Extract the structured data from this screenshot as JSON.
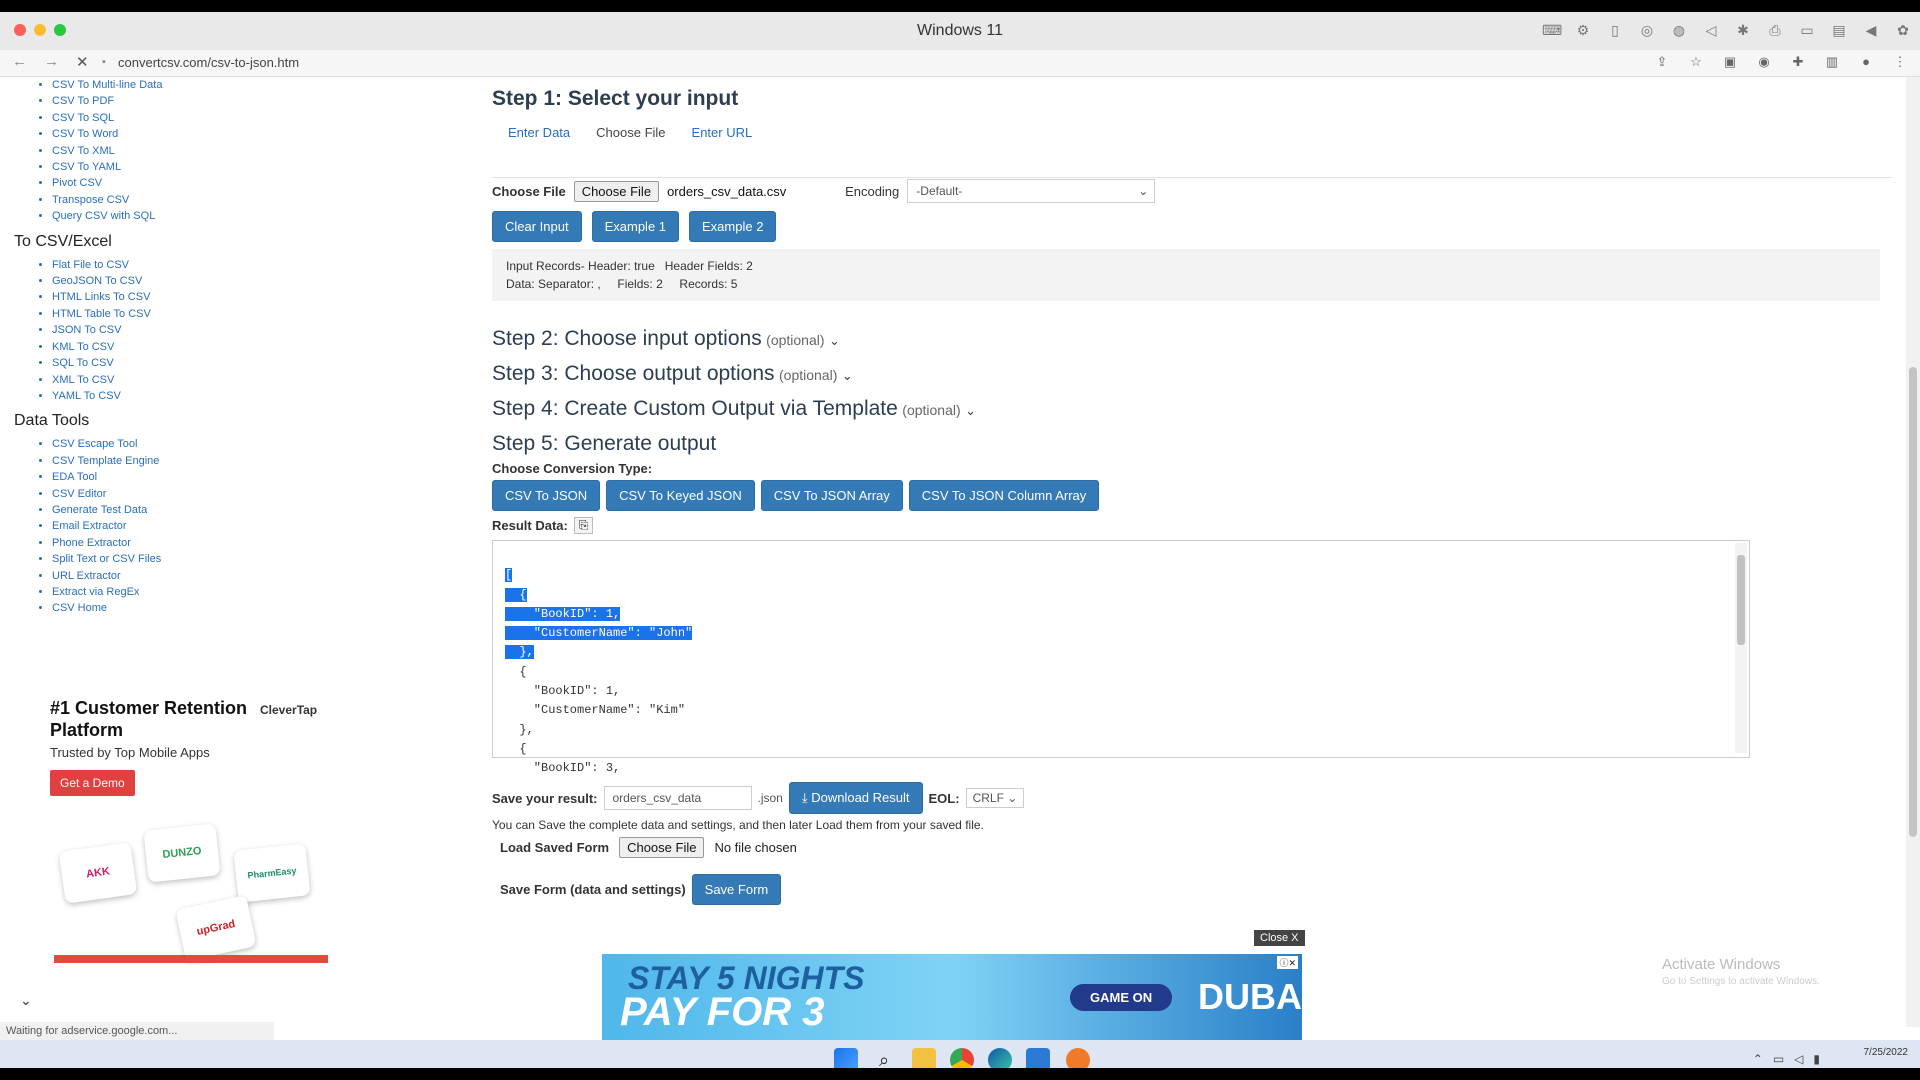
{
  "window": {
    "title": "Windows 11"
  },
  "browser": {
    "url": "convertcsv.com/csv-to-json.htm",
    "status": "Waiting for adservice.google.com..."
  },
  "sidebar": {
    "group1": [
      "CSV To Multi-line Data",
      "CSV To PDF",
      "CSV To SQL",
      "CSV To Word",
      "CSV To XML",
      "CSV To YAML",
      "Pivot CSV",
      "Transpose CSV",
      "Query CSV with SQL"
    ],
    "heading2": "To CSV/Excel",
    "group2": [
      "Flat File to CSV",
      "GeoJSON To CSV",
      "HTML Links To CSV",
      "HTML Table To CSV",
      "JSON To CSV",
      "KML To CSV",
      "SQL To CSV",
      "XML To CSV",
      "YAML To CSV"
    ],
    "heading3": "Data Tools",
    "group3": [
      "CSV Escape Tool",
      "CSV Template Engine",
      "EDA Tool",
      "CSV Editor",
      "Generate Test Data",
      "Email Extractor",
      "Phone Extractor",
      "Split Text or CSV Files",
      "URL Extractor",
      "Extract via RegEx",
      "CSV Home"
    ]
  },
  "ad_left": {
    "headline": "#1 Customer Retention Platform",
    "sub": "Trusted by Top Mobile Apps",
    "cta": "Get a Demo",
    "brand": "CleverTap",
    "tiles": [
      "AKK",
      "DUNZO",
      "PharmEasy",
      "upGrad"
    ]
  },
  "step1": {
    "title": "Step 1: Select your input",
    "tabs": [
      "Enter Data",
      "Choose File",
      "Enter URL"
    ],
    "choose_file_label": "Choose File",
    "file_button": "Choose File",
    "file_name": "orders_csv_data.csv",
    "encoding_label": "Encoding",
    "encoding_value": "-Default-",
    "buttons": {
      "clear": "Clear Input",
      "ex1": "Example 1",
      "ex2": "Example 2"
    },
    "info_line1": "Input Records- Header: true   Header Fields: 2",
    "info_line2": "Data: Separator: ,     Fields: 2     Records: 5"
  },
  "step2": {
    "title": "Step 2: Choose input options",
    "optional": "(optional)"
  },
  "step3": {
    "title": "Step 3: Choose output options",
    "optional": "(optional)"
  },
  "step4": {
    "title": "Step 4: Create Custom Output via Template",
    "optional": "(optional)"
  },
  "step5": {
    "title": "Step 5: Generate output",
    "conversion_label": "Choose Conversion Type:",
    "buttons": [
      "CSV To JSON",
      "CSV To Keyed JSON",
      "CSV To JSON Array",
      "CSV To JSON Column Array"
    ],
    "result_label": "Result Data:",
    "result_lines": [
      "[",
      "  {",
      "    \"BookID\": 1,",
      "    \"CustomerName\": \"John\"",
      "  },",
      "  {",
      "    \"BookID\": 1,",
      "    \"CustomerName\": \"Kim\"",
      "  },",
      "  {",
      "    \"BookID\": 3,"
    ]
  },
  "save": {
    "label": "Save your result:",
    "filename": "orders_csv_data",
    "ext": ".json",
    "download": "Download Result",
    "eol_label": "EOL:",
    "eol_value": "CRLF",
    "note": "You can Save the complete data and settings, and then later Load them from your saved file.",
    "load_label": "Load Saved Form",
    "load_button": "Choose File",
    "load_status": "No file chosen",
    "save_form_label": "Save Form (data and settings)",
    "save_form_button": "Save Form"
  },
  "bottom_ad": {
    "line1": "STAY 5 NIGHTS",
    "line2": "PAY FOR 3",
    "cta": "GAME ON",
    "brand": "DUBAI",
    "close": "Close X"
  },
  "watermark": {
    "line1": "Activate Windows",
    "line2": "Go to Settings to activate Windows."
  },
  "taskbar": {
    "date": "7/25/2022"
  }
}
